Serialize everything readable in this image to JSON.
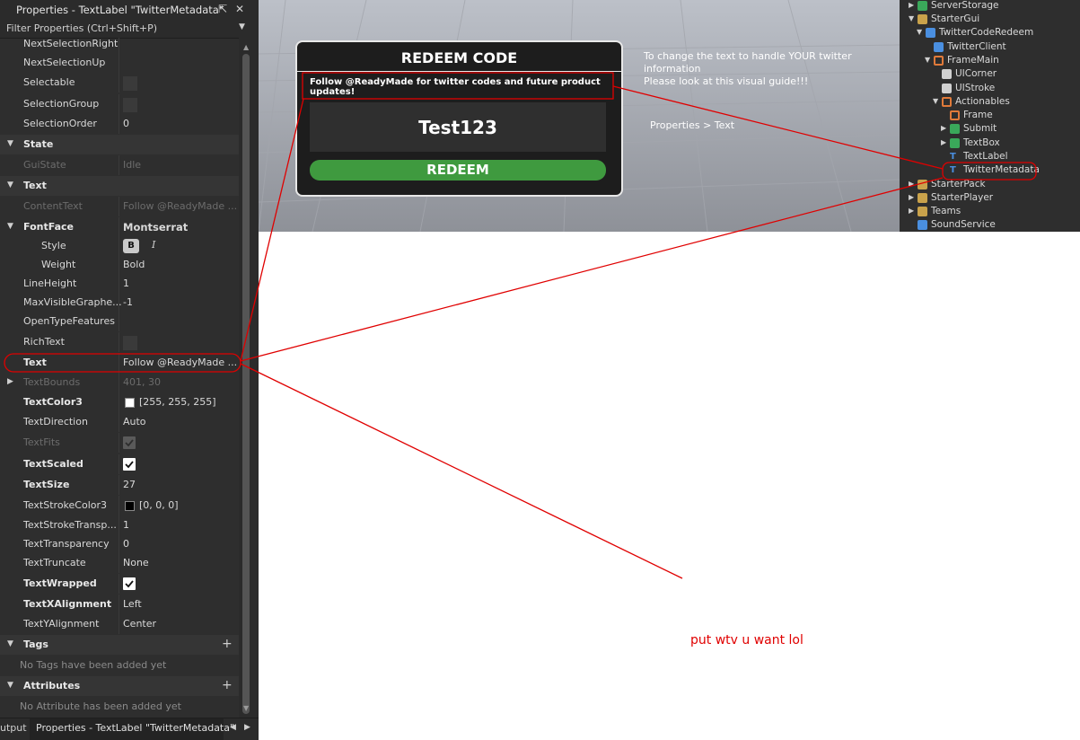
{
  "properties_panel": {
    "title": "Properties - TextLabel \"TwitterMetadata\"",
    "filter_placeholder": "Filter Properties (Ctrl+Shift+P)",
    "rows": {
      "next_selection_right": {
        "name": "NextSelectionRight",
        "value": ""
      },
      "next_selection_up": {
        "name": "NextSelectionUp",
        "value": ""
      },
      "selectable": {
        "name": "Selectable"
      },
      "selection_group": {
        "name": "SelectionGroup"
      },
      "selection_order": {
        "name": "SelectionOrder",
        "value": "0"
      },
      "state_cat": {
        "name": "State"
      },
      "gui_state": {
        "name": "GuiState",
        "value": "Idle"
      },
      "text_cat": {
        "name": "Text"
      },
      "content_text": {
        "name": "ContentText",
        "value": "Follow @ReadyMade ..."
      },
      "font_face": {
        "name": "FontFace",
        "value": "Montserrat"
      },
      "style": {
        "name": "Style",
        "bold": "B",
        "italic": "I"
      },
      "weight": {
        "name": "Weight",
        "value": "Bold"
      },
      "line_height": {
        "name": "LineHeight",
        "value": "1"
      },
      "max_visible": {
        "name": "MaxVisibleGraphe...",
        "value": "-1"
      },
      "open_type": {
        "name": "OpenTypeFeatures",
        "value": ""
      },
      "rich_text": {
        "name": "RichText"
      },
      "text": {
        "name": "Text",
        "value": "Follow @ReadyMade ..."
      },
      "text_bounds": {
        "name": "TextBounds",
        "value": "401, 30"
      },
      "text_color": {
        "name": "TextColor3",
        "value": "[255, 255, 255]"
      },
      "text_direction": {
        "name": "TextDirection",
        "value": "Auto"
      },
      "text_fits": {
        "name": "TextFits"
      },
      "text_scaled": {
        "name": "TextScaled"
      },
      "text_size": {
        "name": "TextSize",
        "value": "27"
      },
      "text_stroke_color": {
        "name": "TextStrokeColor3",
        "value": "[0, 0, 0]"
      },
      "text_stroke_transp": {
        "name": "TextStrokeTransp...",
        "value": "1"
      },
      "text_transparency": {
        "name": "TextTransparency",
        "value": "0"
      },
      "text_truncate": {
        "name": "TextTruncate",
        "value": "None"
      },
      "text_wrapped": {
        "name": "TextWrapped"
      },
      "text_x_alignment": {
        "name": "TextXAlignment",
        "value": "Left"
      },
      "text_y_alignment": {
        "name": "TextYAlignment",
        "value": "Center"
      },
      "tags_cat": {
        "name": "Tags"
      },
      "tags_note": "No Tags have been added yet",
      "attributes_cat": {
        "name": "Attributes"
      },
      "attributes_note": "No Attribute has been added yet"
    },
    "bottom_tabs": {
      "output": "utput",
      "properties": "Properties - TextLabel \"TwitterMetadata\""
    }
  },
  "viewport": {
    "dialog": {
      "title": "REDEEM CODE",
      "metadata_text": "Follow @ReadyMade for twitter codes and future product updates!",
      "textbox_value": "Test123",
      "redeem_label": "REDEEM"
    },
    "note_line1": "To change the text to handle YOUR twitter information",
    "note_line2": "Please look at this visual guide!!!",
    "path_note": "Properties > Text"
  },
  "explorer": {
    "items": {
      "server_storage": "ServerStorage",
      "starter_gui": "StarterGui",
      "twitter_code_redeem": "TwitterCodeRedeem",
      "twitter_client": "TwitterClient",
      "frame_main": "FrameMain",
      "ui_corner": "UICorner",
      "ui_stroke": "UIStroke",
      "actionables": "Actionables",
      "frame": "Frame",
      "submit": "Submit",
      "text_box": "TextBox",
      "text_label": "TextLabel",
      "twitter_metadata": "TwitterMetadata",
      "starter_pack": "StarterPack",
      "starter_player": "StarterPlayer",
      "teams": "Teams",
      "sound_service": "SoundService"
    }
  },
  "annotation_text": "put wtv u want lol",
  "colors": {
    "annotation": "#e00000",
    "panel": "#2e2e2e",
    "redeem_button": "#3f9a3f"
  }
}
